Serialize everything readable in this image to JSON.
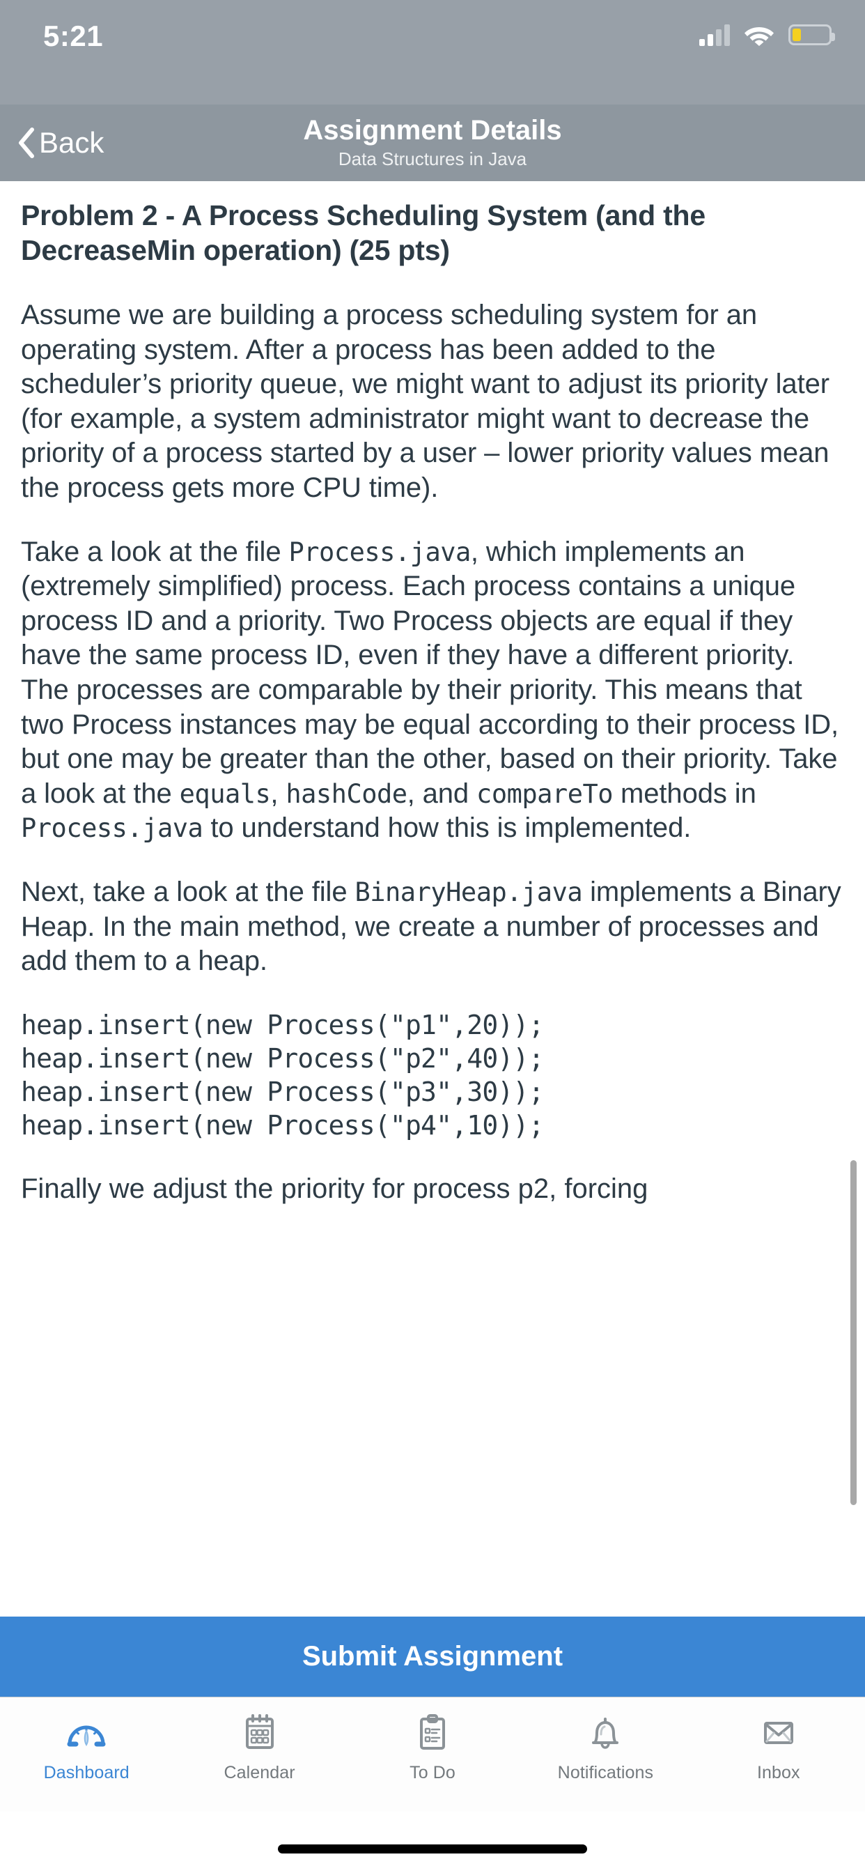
{
  "status_bar": {
    "time": "5:21",
    "signal_icon": "cellular-signal-icon",
    "wifi_icon": "wifi-icon",
    "battery_icon": "battery-low-icon",
    "battery_color": "#f5d020"
  },
  "nav_bar": {
    "back_label": "Back",
    "back_icon": "chevron-left-icon",
    "title": "Assignment Details",
    "subtitle": "Data Structures in Java",
    "background_color": "#8e979f"
  },
  "assignment": {
    "problem_title": "Problem 2 - A Process Scheduling System (and the DecreaseMin operation) (25 pts)",
    "paragraph_1": "Assume we are building a process scheduling system for an operating system. After a process has been added to the scheduler’s priority queue, we might want to adjust its priority later (for example, a system administrator might want to decrease the priority of a process started by a user – lower priority values mean the process gets more CPU time).",
    "paragraph_2_part_1": "Take a look at the file ",
    "paragraph_2_code_1": "Process.java",
    "paragraph_2_part_2": ", which implements an (extremely simplified) process. Each process contains a unique process ID and a priority. Two Process objects are equal if they have the same process ID, even if they have a different priority. The processes are comparable by their priority. This means that two Process instances may be equal according to their process ID, but one may be greater than the other, based on their priority. Take a look at the ",
    "paragraph_2_code_2": "equals",
    "paragraph_2_part_3": ", ",
    "paragraph_2_code_3": "hashCode",
    "paragraph_2_part_4": ", and ",
    "paragraph_2_code_4": "compareTo",
    "paragraph_2_part_5": " methods in ",
    "paragraph_2_code_5": "Process.java",
    "paragraph_2_part_6": " to understand how this is implemented.",
    "paragraph_3_part_1": "Next, take a look at the file ",
    "paragraph_3_code_1": "BinaryHeap.java",
    "paragraph_3_part_2": " implements a Binary Heap. In the main method, we create a number of processes and add them to a heap.",
    "code_block": "heap.insert(new Process(\"p1\",20));\nheap.insert(new Process(\"p2\",40));\nheap.insert(new Process(\"p3\",30));\nheap.insert(new Process(\"p4\",10));",
    "paragraph_4_cut_off": "Finally we adjust the priority for process p2, forcing",
    "text_color": "#2d3b45"
  },
  "submit_button": {
    "label": "Submit Assignment",
    "background_color": "#3b86d4"
  },
  "tab_bar": {
    "items": [
      {
        "label": "Dashboard",
        "icon": "dashboard-gauge-icon",
        "active": true
      },
      {
        "label": "Calendar",
        "icon": "calendar-icon",
        "active": false
      },
      {
        "label": "To Do",
        "icon": "clipboard-list-icon",
        "active": false
      },
      {
        "label": "Notifications",
        "icon": "bell-icon",
        "active": false
      },
      {
        "label": "Inbox",
        "icon": "envelope-icon",
        "active": false
      }
    ],
    "active_color": "#3b86d4",
    "inactive_color": "#73797d"
  },
  "home_indicator": {
    "icon": "home-indicator"
  }
}
